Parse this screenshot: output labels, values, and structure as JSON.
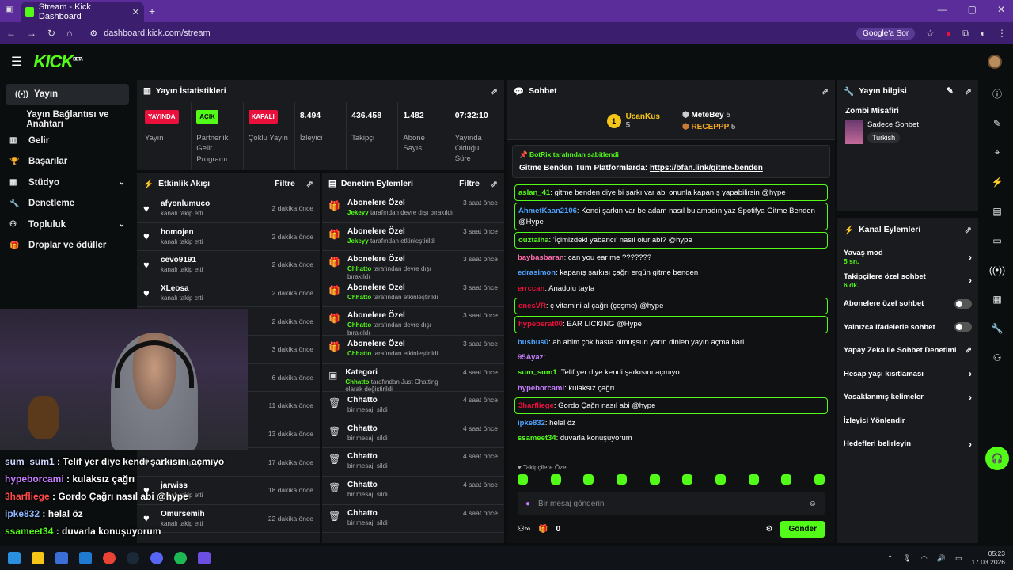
{
  "browser": {
    "tab_title": "Stream - Kick Dashboard",
    "url": "dashboard.kick.com/stream",
    "google_label": "Google'a Sor"
  },
  "app": {
    "logo": "KICK",
    "logo_tag": "BETA"
  },
  "sidebar": {
    "items": [
      {
        "label": "Yayın",
        "icon": "broadcast-icon",
        "active": true
      },
      {
        "label": "Yayın Bağlantısı ve Anahtarı",
        "icon": ""
      },
      {
        "label": "Gelir",
        "icon": "chart-icon"
      },
      {
        "label": "Başarılar",
        "icon": "trophy-icon"
      },
      {
        "label": "Stüdyo",
        "icon": "layout-icon",
        "chevron": true
      },
      {
        "label": "Denetleme",
        "icon": "wrench-icon"
      },
      {
        "label": "Topluluk",
        "icon": "community-icon",
        "chevron": true
      },
      {
        "label": "Droplar ve ödüller",
        "icon": "gift-icon"
      }
    ]
  },
  "stats": {
    "title": "Yayın İstatistikleri",
    "items": [
      {
        "badge": "YAYINDA",
        "badge_color": "#e9113c",
        "label": "Yayın"
      },
      {
        "badge": "AÇIK",
        "badge_color": "#53fc18",
        "label": "Partnerlik Gelir Programı"
      },
      {
        "badge": "KAPALI",
        "badge_color": "#e9113c",
        "label": "Çoklu Yayın"
      },
      {
        "value": "8.494",
        "label": "İzleyici"
      },
      {
        "value": "436.458",
        "label": "Takipçi"
      },
      {
        "value": "1.482",
        "label": "Abone Sayısı"
      },
      {
        "value": "07:32:10",
        "label": "Yayında Olduğu Süre"
      }
    ]
  },
  "activity": {
    "title": "Etkinlik Akışı",
    "filter": "Filtre",
    "items": [
      {
        "name": "afyonlumuco",
        "sub": "kanalı takip etti",
        "time": "2 dakika önce"
      },
      {
        "name": "homojen",
        "sub": "kanalı takip etti",
        "time": "2 dakika önce"
      },
      {
        "name": "cevo9191",
        "sub": "kanalı takip etti",
        "time": "2 dakika önce"
      },
      {
        "name": "XLeosa",
        "sub": "kanalı takip etti",
        "time": "2 dakika önce"
      },
      {
        "name": "",
        "sub": "",
        "time": "2 dakika önce"
      },
      {
        "name": "",
        "sub": "",
        "time": "3 dakika önce"
      },
      {
        "name": "",
        "sub": "",
        "time": "6 dakika önce"
      },
      {
        "name": "",
        "sub": "",
        "time": "11 dakika önce"
      },
      {
        "name": "",
        "sub": "",
        "time": "13 dakika önce"
      },
      {
        "name": "",
        "sub": "kanalı takip etti",
        "time": "17 dakika önce"
      },
      {
        "name": "jarwiss",
        "sub": "kanalı takip etti",
        "time": "18 dakika önce"
      },
      {
        "name": "Omursemih",
        "sub": "kanalı takip etti",
        "time": "22 dakika önce"
      }
    ]
  },
  "moderation": {
    "title": "Denetim Eylemleri",
    "filter": "Filtre",
    "items": [
      {
        "title": "Abonelere Özel",
        "actor": "Jekeyy",
        "rest": "tarafından devre dışı bırakıldı",
        "time": "3 saat önce",
        "icon": "gift-icon"
      },
      {
        "title": "Abonelere Özel",
        "actor": "Jekeyy",
        "rest": "tarafından etkinleştirildi",
        "time": "3 saat önce",
        "icon": "gift-icon"
      },
      {
        "title": "Abonelere Özel",
        "actor": "Chhatto",
        "rest": "tarafından devre dışı bırakıldı",
        "time": "3 saat önce",
        "icon": "gift-icon"
      },
      {
        "title": "Abonelere Özel",
        "actor": "Chhatto",
        "rest": "tarafından etkinleştirildi",
        "time": "3 saat önce",
        "icon": "gift-icon"
      },
      {
        "title": "Abonelere Özel",
        "actor": "Chhatto",
        "rest": "tarafından devre dışı bırakıldı",
        "time": "3 saat önce",
        "icon": "gift-icon"
      },
      {
        "title": "Abonelere Özel",
        "actor": "Chhatto",
        "rest": "tarafından etkinleştirildi",
        "time": "3 saat önce",
        "icon": "gift-icon"
      },
      {
        "title": "Kategori",
        "actor": "Chhatto",
        "rest": "tarafından Just Chatting olarak değiştirildi",
        "time": "4 saat önce",
        "icon": "category-icon"
      },
      {
        "title": "Chhatto",
        "actor": "",
        "rest": "bir mesajı sildi",
        "time": "4 saat önce",
        "icon": "trash-icon"
      },
      {
        "title": "Chhatto",
        "actor": "",
        "rest": "bir mesajı sildi",
        "time": "4 saat önce",
        "icon": "trash-icon"
      },
      {
        "title": "Chhatto",
        "actor": "",
        "rest": "bir mesajı sildi",
        "time": "4 saat önce",
        "icon": "trash-icon"
      },
      {
        "title": "Chhatto",
        "actor": "",
        "rest": "bir mesajı sildi",
        "time": "4 saat önce",
        "icon": "trash-icon"
      },
      {
        "title": "Chhatto",
        "actor": "",
        "rest": "bir mesajı sildi",
        "time": "4 saat önce",
        "icon": "trash-icon"
      }
    ]
  },
  "chat": {
    "title": "Sohbet",
    "leaders": [
      {
        "rank": "1",
        "name": "UcanKus",
        "count": "5"
      },
      {
        "name": "MeteBey",
        "count": "5"
      },
      {
        "name": "RECEPPP",
        "count": "5"
      }
    ],
    "pinned_by": "BotRix tarafından sabitlendi",
    "pinned_text": "Gitme Benden Tüm Platformlarda: ",
    "pinned_link": "https://bfan.link/gitme-benden",
    "messages": [
      {
        "user": "aslan_41",
        "color": "#53fc18",
        "text": "gitme benden diye bi şarkı var abi onunla kapanış yapabilirsin @hype",
        "hl": true
      },
      {
        "user": "AhmetKaan2106",
        "color": "#4fa3ff",
        "text": "Kendi şarkın var be adam nasıl bulamadın yaz Spotifya Gitme Benden @Hype",
        "hl": true
      },
      {
        "user": "ouztalha",
        "color": "#53fc18",
        "text": "'İçimizdeki yabancı' nasıl olur abi? @hype",
        "hl": true
      },
      {
        "user": "baybasbaran",
        "color": "#ff6fae",
        "text": "can you ear me ???????",
        "hl": false
      },
      {
        "user": "edrasimon",
        "color": "#4fa3ff",
        "text": "kapanış şarkısı çağrı ergün gitme benden",
        "hl": false
      },
      {
        "user": "errccan",
        "color": "#e9113c",
        "text": "Anadolu tayfa",
        "hl": false
      },
      {
        "user": "enesVR",
        "color": "#e9113c",
        "text": "ç vitamini al çağrı (çeşme) @hype",
        "hl": true
      },
      {
        "user": "hypeberat00",
        "color": "#e9113c",
        "text": "EAR LICKING @Hype",
        "hl": true
      },
      {
        "user": "busbus0",
        "color": "#4fa3ff",
        "text": "ah abim çok hasta olmuşsun yarın dinlen yayın açma bari",
        "hl": false
      },
      {
        "user": "95Ayaz",
        "color": "#c77dff",
        "text": "",
        "hl": false
      },
      {
        "user": "sum_sum1",
        "color": "#53fc18",
        "text": "Telif yer diye kendi şarkısını açmıyo",
        "hl": false
      },
      {
        "user": "hypeborcami",
        "color": "#c77dff",
        "text": "kulaksız çağrı",
        "hl": false
      },
      {
        "user": "3harfliege",
        "color": "#e9113c",
        "text": "Gordo Çağrı nasıl abi @hype",
        "hl": true
      },
      {
        "user": "ipke832",
        "color": "#4fa3ff",
        "text": "helal öz",
        "hl": false
      },
      {
        "user": "ssameet34",
        "color": "#53fc18",
        "text": "duvarla konuşuyorum",
        "hl": false
      }
    ],
    "followers_only": "Takipçilere Özel",
    "placeholder": "Bir mesaj gönderin",
    "points": "0",
    "send": "Gönder"
  },
  "streaminfo": {
    "title": "Yayın bilgisi",
    "stream_title": "Zombi Misafiri",
    "category": "Sadece Sohbet",
    "tag": "Turkish"
  },
  "channel_actions": {
    "title": "Kanal Eylemleri",
    "items": [
      {
        "label": "Yavaş mod",
        "sub": "5 sn.",
        "ctl": "arrow"
      },
      {
        "label": "Takipçilere özel sohbet",
        "sub": "6 dk.",
        "ctl": "arrow"
      },
      {
        "label": "Abonelere özel sohbet",
        "sub": "",
        "ctl": "toggle"
      },
      {
        "label": "Yalnızca ifadelerle sohbet",
        "sub": "",
        "ctl": "toggle"
      },
      {
        "label": "Yapay Zeka ile Sohbet Denetimi",
        "sub": "",
        "ctl": "external"
      },
      {
        "label": "Hesap yaşı kısıtlaması",
        "sub": "",
        "ctl": "arrow"
      },
      {
        "label": "Yasaklanmış kelimeler",
        "sub": "",
        "ctl": "arrow"
      },
      {
        "label": "İzleyici Yönlendir",
        "sub": "",
        "ctl": "none"
      },
      {
        "label": "Hedefleri belirleyin",
        "sub": "",
        "ctl": "arrow"
      }
    ]
  },
  "overlay_chat": [
    {
      "user": "sum_sum1",
      "color": "#cfd8ff",
      "text": " : Telif yer diye kendi şarkısını açmıyo"
    },
    {
      "user": "hypeborcami",
      "color": "#c77dff",
      "text": " : kulaksız çağrı"
    },
    {
      "user": "3harfliege",
      "color": "#ff4a4a",
      "text": " : Gordo Çağrı nasıl abi @hype"
    },
    {
      "user": "ipke832",
      "color": "#8fb8ff",
      "text": " : helal öz"
    },
    {
      "user": "ssameet34",
      "color": "#53fc18",
      "text": " : duvarla konuşuyorum"
    }
  ],
  "taskbar": {
    "time": "05:23",
    "date": "17.03.2026"
  }
}
